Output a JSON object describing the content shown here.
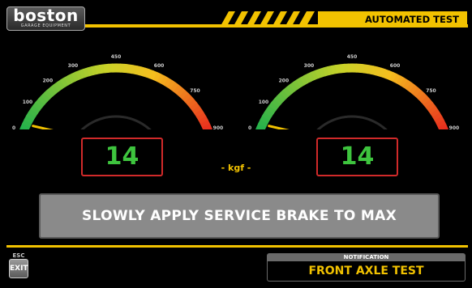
{
  "header": {
    "logo_word": "boston",
    "logo_subtext": "GARAGE EQUIPMENT",
    "banner": "AUTOMATED TEST"
  },
  "gauges": [
    {
      "id": "left",
      "value": 14,
      "value_text": "14",
      "max": 900,
      "tick_labels": [
        "0",
        "100",
        "200",
        "300",
        "450",
        "600",
        "750",
        "900"
      ]
    },
    {
      "id": "right",
      "value": 14,
      "value_text": "14",
      "max": 900,
      "tick_labels": [
        "0",
        "100",
        "200",
        "300",
        "450",
        "600",
        "750",
        "900"
      ]
    }
  ],
  "unit_label": "- kgf -",
  "instruction": "SLOWLY APPLY SERVICE BRAKE TO MAX",
  "footer": {
    "esc_label": "ESC",
    "exit_label": "EXIT",
    "notification_title": "NOTIFICATION",
    "notification_text": "FRONT AXLE TEST"
  },
  "colors": {
    "accent": "#f2c200",
    "value_text": "#3ec43e",
    "value_border": "#d12a2a",
    "gauge_low": "#22b14c",
    "gauge_high": "#e8231e"
  }
}
